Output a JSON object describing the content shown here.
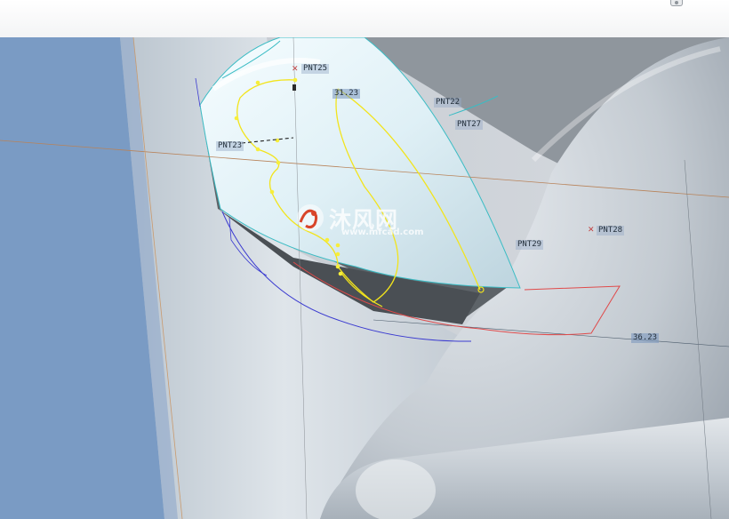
{
  "watermark": {
    "name": "沐风网",
    "url": "www.mfcad.com"
  },
  "annotations": {
    "pnt25": "PNT25",
    "pnt22": "PNT22",
    "pnt27": "PNT27",
    "pnt23": "PNT23",
    "pnt29": "PNT29",
    "pnt28": "PNT28",
    "dim_top": "31.23",
    "dim_right": "36.23"
  },
  "colors": {
    "surface_highlight": "#e8f7fb",
    "curve_yellow": "#f2e41c",
    "edge_cyan": "#3bbcc4",
    "edge_red": "#e04a4a",
    "edge_blue": "#3a3ad0",
    "sketch_plane": "#7b9cc4"
  },
  "icons": [
    "logo-icon",
    "point-marker-icon"
  ]
}
